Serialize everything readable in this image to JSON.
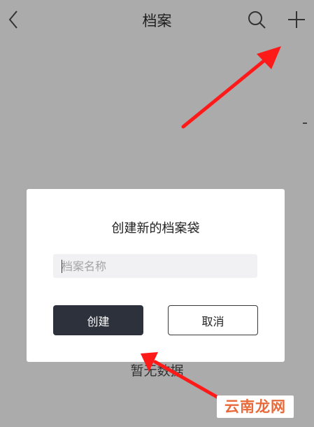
{
  "header": {
    "title": "档案",
    "back_icon": "chevron-left-icon",
    "search_icon": "search-icon",
    "add_icon": "plus-icon"
  },
  "empty_state": {
    "text": "暂无数据"
  },
  "dialog": {
    "title": "创建新的档案袋",
    "name_input": {
      "placeholder": "档案名称",
      "value": ""
    },
    "create_label": "创建",
    "cancel_label": "取消"
  },
  "watermark": {
    "text": "云南龙网"
  },
  "colors": {
    "overlay": "#ababab",
    "dialog_bg": "#ffffff",
    "input_bg": "#f1f1f3",
    "primary_button": "#2c313c",
    "arrow": "#ff1a1a",
    "watermark_text": "#e86a3a"
  }
}
